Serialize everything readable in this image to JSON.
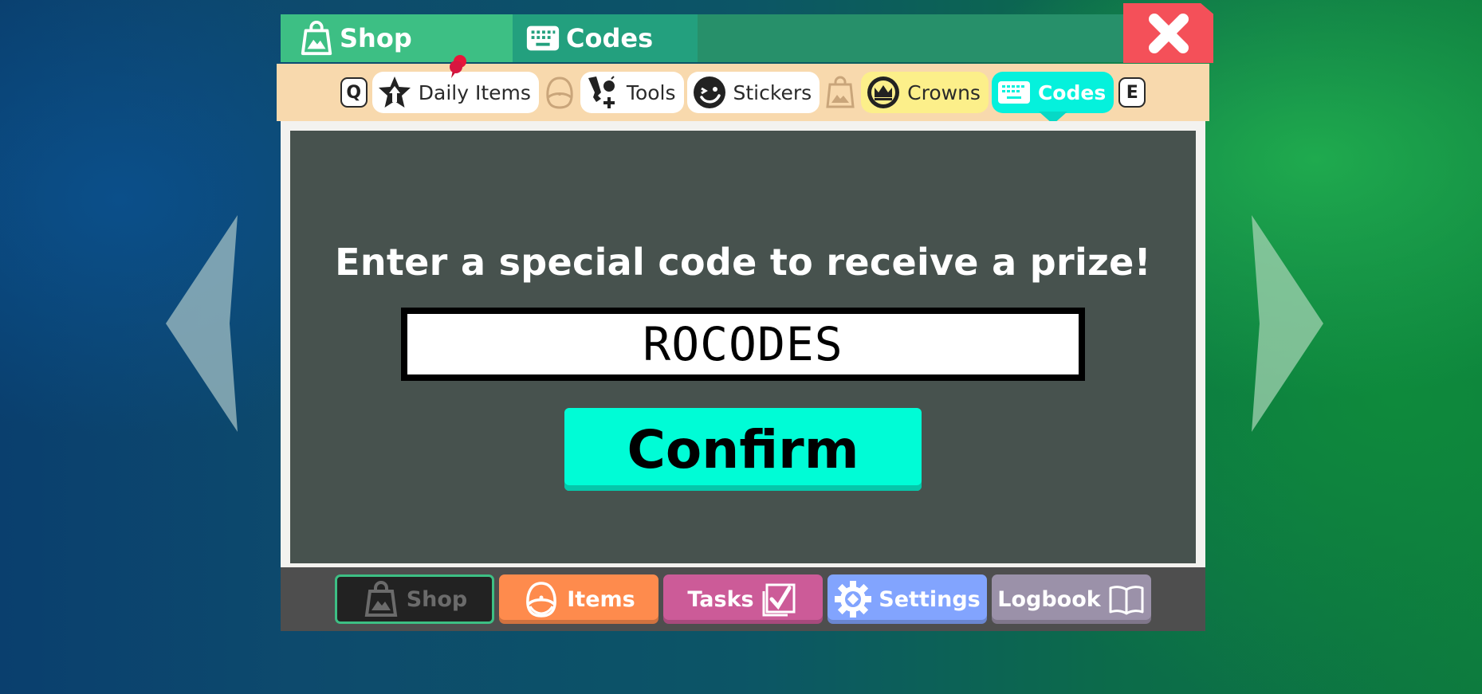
{
  "colors": {
    "shop_tab": "#3dbf84",
    "codes_tab": "#23a07e",
    "titlebar": "#27906a",
    "close": "#f45059",
    "subbar": "#f8d9ad",
    "panel": "#47524e",
    "confirm": "#00fcd6",
    "codes_subtab": "#05f1dc",
    "crowns_subtab": "#fcef8a",
    "items": "#fe8b4d",
    "tasks": "#cc5b98",
    "settings": "#82a4fe",
    "logbook": "#9b91a9"
  },
  "header": {
    "tabs": [
      {
        "label": "Shop",
        "icon": "shopping-bag-icon"
      },
      {
        "label": "Codes",
        "icon": "keyboard-icon"
      }
    ],
    "close_icon": "close-icon"
  },
  "subtabs": {
    "prev_key": "Q",
    "next_key": "E",
    "items": [
      {
        "label": "Daily Items",
        "icon": "star-up-icon",
        "notification": true
      },
      {
        "label": "",
        "icon": "backpack-icon",
        "locked": true
      },
      {
        "label": "Tools",
        "icon": "tools-icon"
      },
      {
        "label": "Stickers",
        "icon": "smiley-icon"
      },
      {
        "label": "",
        "icon": "shopping-bag-icon",
        "locked": true
      },
      {
        "label": "Crowns",
        "icon": "crown-icon"
      },
      {
        "label": "Codes",
        "icon": "keyboard-icon",
        "active": true
      }
    ]
  },
  "codes": {
    "prompt": "Enter a special code to receive a prize!",
    "input_value": "ROCODES",
    "confirm_label": "Confirm"
  },
  "bottom_nav": [
    {
      "label": "Shop",
      "icon": "shopping-bag-icon",
      "active": true
    },
    {
      "label": "Items",
      "icon": "backpack-icon"
    },
    {
      "label": "Tasks",
      "icon": "checklist-icon"
    },
    {
      "label": "Settings",
      "icon": "gear-icon"
    },
    {
      "label": "Logbook",
      "icon": "book-icon"
    }
  ]
}
